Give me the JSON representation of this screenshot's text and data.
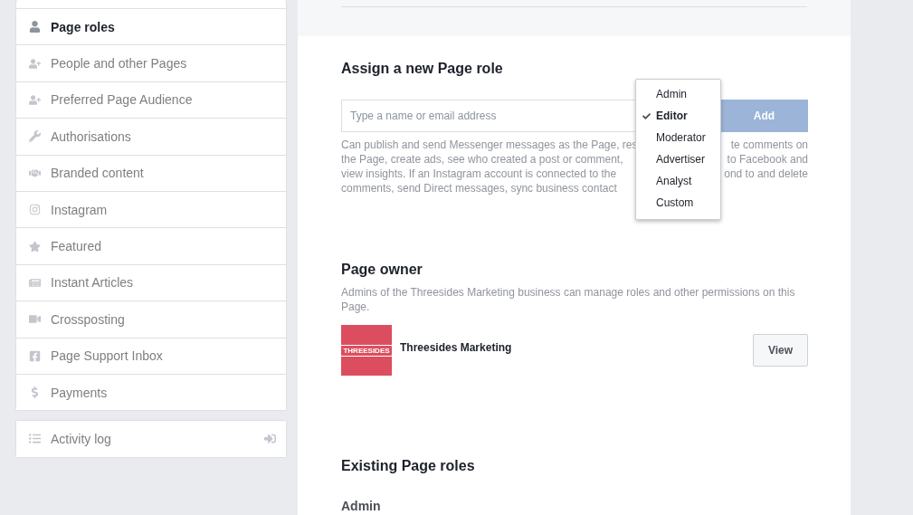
{
  "sidebar": {
    "items": [
      {
        "label": "Page roles",
        "selected": true
      },
      {
        "label": "People and other Pages",
        "selected": false
      },
      {
        "label": "Preferred Page Audience",
        "selected": false
      },
      {
        "label": "Authorisations",
        "selected": false
      },
      {
        "label": "Branded content",
        "selected": false
      },
      {
        "label": "Instagram",
        "selected": false
      },
      {
        "label": "Featured",
        "selected": false
      },
      {
        "label": "Instant Articles",
        "selected": false
      },
      {
        "label": "Crossposting",
        "selected": false
      },
      {
        "label": "Page Support Inbox",
        "selected": false
      },
      {
        "label": "Payments",
        "selected": false
      }
    ],
    "activity_log": {
      "label": "Activity log"
    }
  },
  "assign": {
    "title": "Assign a new Page role",
    "input": {
      "placeholder": "Type a name or email address"
    },
    "add_button": "Add",
    "description_lines": [
      {
        "left": "Can publish and send Messenger messages as the Page, res",
        "right": "te comments on"
      },
      {
        "left": "the Page, create ads, see who created a post or comment,",
        "right": "to Facebook and"
      },
      {
        "left": "view insights. If an Instagram account is connected to the",
        "right": "ond to and delete"
      },
      {
        "left": "comments, send Direct messages, sync business contact"
      }
    ],
    "role_menu": [
      {
        "label": "Admin",
        "selected": false
      },
      {
        "label": "Editor",
        "selected": true
      },
      {
        "label": "Moderator",
        "selected": false
      },
      {
        "label": "Advertiser",
        "selected": false
      },
      {
        "label": "Analyst",
        "selected": false
      },
      {
        "label": "Custom",
        "selected": false
      }
    ]
  },
  "owner": {
    "title": "Page owner",
    "description": "Admins of the Threesides Marketing business can manage roles and other permissions on this Page.",
    "logo_text": "THREESIDES",
    "name": "Threesides Marketing",
    "view_button": "View"
  },
  "existing": {
    "title": "Existing Page roles",
    "subtitle": "Admin"
  }
}
